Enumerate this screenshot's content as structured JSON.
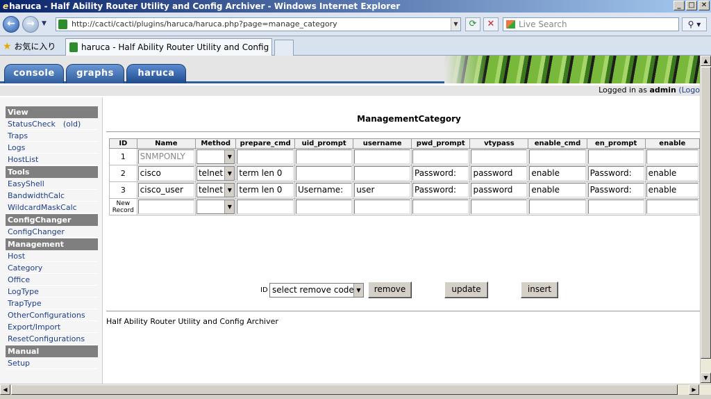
{
  "window": {
    "title": "haruca - Half Ability Router Utility and Config Archiver - Windows Internet Explorer"
  },
  "browser": {
    "address": "http://cacti/cacti/plugins/haruca/haruca.php?page=manage_category",
    "search_placeholder": "Live Search",
    "favorites_label": "お気に入り",
    "tab_title": "haruca - Half Ability Router Utility and Config Arc..."
  },
  "cacti": {
    "tabs": [
      "console",
      "graphs",
      "haruca"
    ],
    "active_tab": "haruca",
    "logged_in_prefix": "Logged in as",
    "user": "admin",
    "logout_fragment": "(Logo"
  },
  "sidebar": {
    "sections": [
      {
        "header": "View",
        "items": [
          "StatusCheck　(old)",
          "Traps",
          "Logs",
          "HostList"
        ]
      },
      {
        "header": "Tools",
        "items": [
          "EasyShell",
          "BandwidthCalc",
          "WildcardMaskCalc"
        ]
      },
      {
        "header": "ConfigChanger",
        "items": [
          "ConfigChanger"
        ]
      },
      {
        "header": "Management",
        "items": [
          "Host",
          "Category",
          "Office",
          "LogType",
          "TrapType",
          "OtherConfigurations",
          "Export/Import",
          "ResetConfigurations"
        ]
      },
      {
        "header": "Manual",
        "items": [
          "Setup"
        ]
      }
    ]
  },
  "main": {
    "title": "ManagementCategory",
    "columns": [
      "ID",
      "Name",
      "Method",
      "prepare_cmd",
      "uid_prompt",
      "username",
      "pwd_prompt",
      "vtypass",
      "enable_cmd",
      "en_prompt",
      "enable"
    ],
    "rows": [
      {
        "id": "1",
        "name": "SNMPONLY",
        "method": "",
        "prepare_cmd": "",
        "uid_prompt": "",
        "username": "",
        "pwd_prompt": "",
        "vtypass": "",
        "enable_cmd": "",
        "en_prompt": "",
        "enable": ""
      },
      {
        "id": "2",
        "name": "cisco",
        "method": "telnet",
        "prepare_cmd": "term len 0",
        "uid_prompt": "",
        "username": "",
        "pwd_prompt": "Password:",
        "vtypass": "password",
        "enable_cmd": "enable",
        "en_prompt": "Password:",
        "enable": "enable"
      },
      {
        "id": "3",
        "name": "cisco_user",
        "method": "telnet",
        "prepare_cmd": "term len 0",
        "uid_prompt": "Username:",
        "username": "user",
        "pwd_prompt": "Password:",
        "vtypass": "password",
        "enable_cmd": "enable",
        "en_prompt": "Password:",
        "enable": "enable"
      }
    ],
    "new_record_label": "New Record",
    "id_label": "ID",
    "remove_select": "select remove code",
    "remove_button": "remove",
    "update_button": "update",
    "insert_button": "insert",
    "footer": "Half Ability Router Utility and Config Archiver"
  }
}
